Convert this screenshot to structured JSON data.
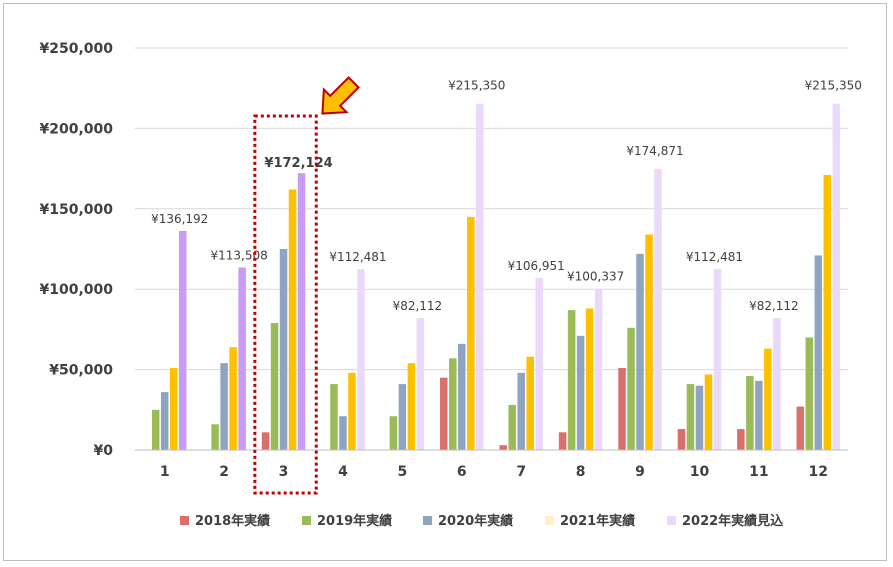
{
  "chart_data": {
    "type": "bar",
    "categories": [
      "1",
      "2",
      "3",
      "4",
      "5",
      "6",
      "7",
      "8",
      "9",
      "10",
      "11",
      "12"
    ],
    "yticks": [
      "¥0",
      "¥50,000",
      "¥100,000",
      "¥150,000",
      "¥200,000",
      "¥250,000"
    ],
    "ylim": [
      0,
      250000
    ],
    "grid": true,
    "legend_position": "bottom",
    "series": [
      {
        "name": "2018年実績",
        "color": "#d9706b",
        "values": [
          0,
          0,
          11000,
          0,
          0,
          45000,
          3000,
          11000,
          51000,
          13000,
          13000,
          27000
        ]
      },
      {
        "name": "2019年実績",
        "color": "#9bbb59",
        "values": [
          25000,
          16000,
          79000,
          41000,
          21000,
          57000,
          28000,
          87000,
          76000,
          41000,
          46000,
          70000
        ]
      },
      {
        "name": "2020年実績",
        "color": "#8ea4c0",
        "values": [
          36000,
          54000,
          125000,
          21000,
          41000,
          66000,
          48000,
          71000,
          122000,
          40000,
          43000,
          121000
        ]
      },
      {
        "name": "2021年実績",
        "color": "#ffc000",
        "legend_color": "#fff2c0",
        "values": [
          51000,
          64000,
          162000,
          48000,
          54000,
          145000,
          58000,
          88000,
          134000,
          47000,
          63000,
          171000
        ]
      },
      {
        "name": "2022年実績見込",
        "color": "#ead9fb",
        "highlight_color": "#c89cf5",
        "values": [
          136192,
          113508,
          172124,
          112481,
          82112,
          215350,
          106951,
          100337,
          174871,
          112481,
          82112,
          215350
        ]
      }
    ],
    "data_labels": [
      "¥136,192",
      "¥113,508",
      "¥172,124",
      "¥112,481",
      "¥82,112",
      "¥215,350",
      "¥106,951",
      "¥100,337",
      "¥174,871",
      "¥112,481",
      "¥82,112",
      "¥215,350"
    ],
    "highlighted_categories": [
      0,
      1,
      2
    ],
    "annotation": {
      "type": "dotted-box-with-arrow",
      "category_index": 2,
      "color": "#c00000",
      "arrow_color": "#ffc000"
    }
  }
}
